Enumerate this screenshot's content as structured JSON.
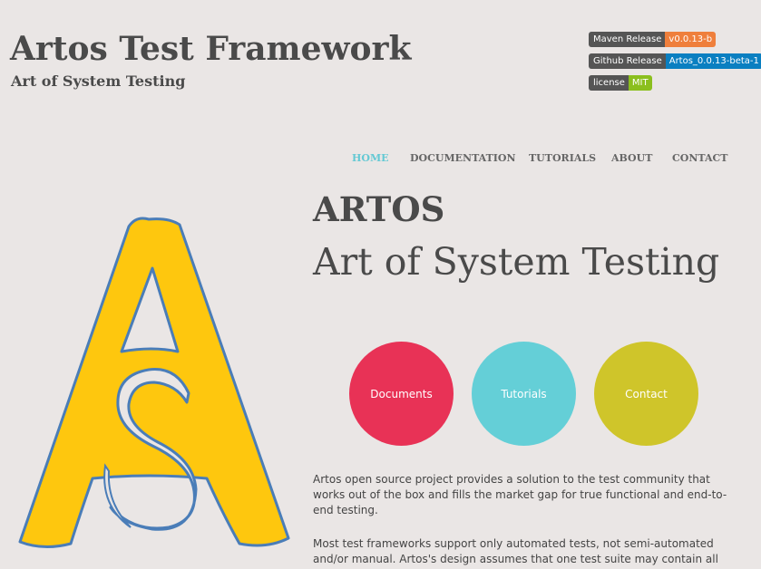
{
  "header": {
    "title": "Artos Test Framework",
    "tagline": "Art of System Testing"
  },
  "badges": [
    {
      "label": "Maven Release",
      "value": "v0.0.13-b",
      "color": "#ef7f3c"
    },
    {
      "label": "Github Release",
      "value": "Artos_0.0.13-beta-1",
      "color": "#0a7fc1"
    },
    {
      "label": "license",
      "value": "MIT",
      "color": "#8bbf1e"
    }
  ],
  "nav": {
    "items": [
      {
        "label": "HOME",
        "active": true
      },
      {
        "label": "DOCUMENTATION",
        "active": false
      },
      {
        "label": "TUTORIALS",
        "active": false
      },
      {
        "label": "ABOUT",
        "active": false
      },
      {
        "label": "CONTACT",
        "active": false
      }
    ],
    "active_color": "#64c9d4",
    "color": "#666666"
  },
  "hero": {
    "title": "ARTOS",
    "subtitle": "Art of System Testing"
  },
  "logo": {
    "icon": "artos-logo-icon",
    "fill": "#fec70e",
    "outline": "#4a7db8"
  },
  "circles": [
    {
      "label": "Documents",
      "color": "#e83256"
    },
    {
      "label": "Tutorials",
      "color": "#64cfd7"
    },
    {
      "label": "Contact",
      "color": "#cfc52a"
    }
  ],
  "content": {
    "paragraphs": [
      "Artos open source project provides a solution to the test community that works out of the box and fills the market gap for true functional and end-to-end testing.",
      "Most test frameworks support only automated tests, not semi-automated and/or manual. Artos's design assumes that one test suite may contain all"
    ]
  }
}
